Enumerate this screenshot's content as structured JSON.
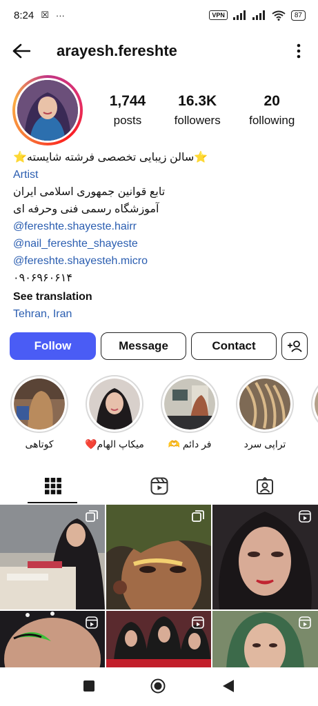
{
  "status": {
    "time": "8:24",
    "vpn": "VPN",
    "battery": "87"
  },
  "header": {
    "username": "arayesh.fereshte"
  },
  "stats": {
    "posts_count": "1,744",
    "posts_label": "posts",
    "followers_count": "16.3K",
    "followers_label": "followers",
    "following_count": "20",
    "following_label": "following"
  },
  "bio": {
    "name_line": "⭐سالن زیبایی  تخصصی فرشته شایسته⭐",
    "category": "Artist",
    "line1": "تابع قوانین جمهوری اسلامی ایران",
    "line2": "آموزشگاه رسمی فنی وحرفه ای",
    "mention1": "@fereshte.shayeste.hairr",
    "mention2": "@nail_fereshte_shayeste",
    "mention3": "@fereshte.shayesteh.micro",
    "phone": "۰۹۰۶۹۶۰۶۱۴",
    "see_translation": "See translation",
    "location": "Tehran, Iran"
  },
  "actions": {
    "follow": "Follow",
    "message": "Message",
    "contact": "Contact"
  },
  "highlights": [
    {
      "label": "کوتاهی"
    },
    {
      "label": "میکاپ الهام❤️"
    },
    {
      "label": "فر دائم 🫶"
    },
    {
      "label": "تراپی سرد"
    }
  ],
  "colors": {
    "follow_button": "#4a5cf5",
    "link_blue": "#2a5db0"
  },
  "icons": {
    "back": "arrow-left-icon",
    "more": "more-vertical-icon",
    "add_user": "add-user-icon",
    "grid_tab": "grid-icon",
    "reels_tab": "reels-icon",
    "tagged_tab": "tagged-icon",
    "nav_recent": "square-icon",
    "nav_home": "circle-icon",
    "nav_back": "triangle-back-icon"
  }
}
